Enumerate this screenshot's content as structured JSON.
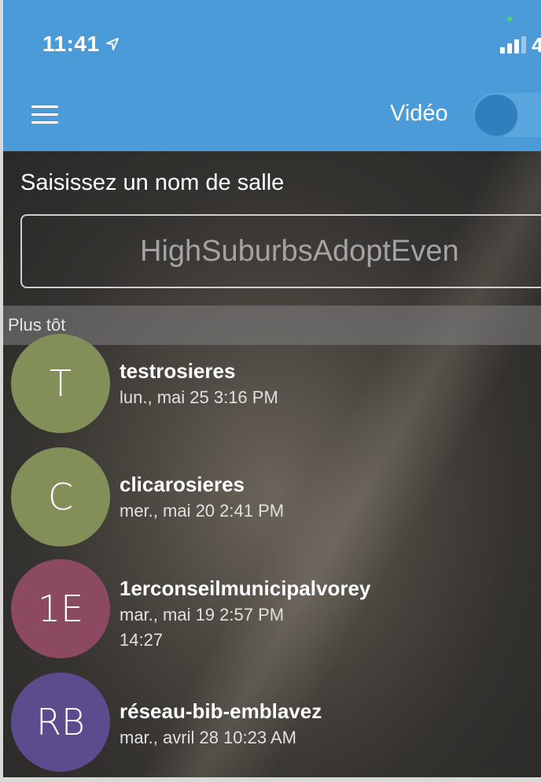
{
  "status_bar": {
    "time": "11:41",
    "battery": "4"
  },
  "app_bar": {
    "video_label": "Vidéo",
    "video_enabled": false
  },
  "room_form": {
    "prompt": "Saisissez un nom de salle",
    "placeholder": "HighSuburbsAdoptEven"
  },
  "recent": {
    "section_title": "Plus tôt",
    "rooms": [
      {
        "initials": "T",
        "name": "testrosieres",
        "date": "lun., mai 25 3:16 PM",
        "extra": "",
        "color": "#838f58"
      },
      {
        "initials": "C",
        "name": "clicarosieres",
        "date": "mer., mai 20 2:41 PM",
        "extra": "",
        "color": "#838f58"
      },
      {
        "initials": "1E",
        "name": "1erconseilmunicipalvorey",
        "date": "mar., mai 19 2:57 PM",
        "extra": "14:27",
        "color": "#8c4a62"
      },
      {
        "initials": "RB",
        "name": "réseau-bib-emblavez",
        "date": "mar., avril 28 10:23 AM",
        "extra": "",
        "color": "#5b4c8e"
      }
    ]
  },
  "colors": {
    "header": "#4a9bd8",
    "toggle_knob": "#2f7fbf"
  }
}
